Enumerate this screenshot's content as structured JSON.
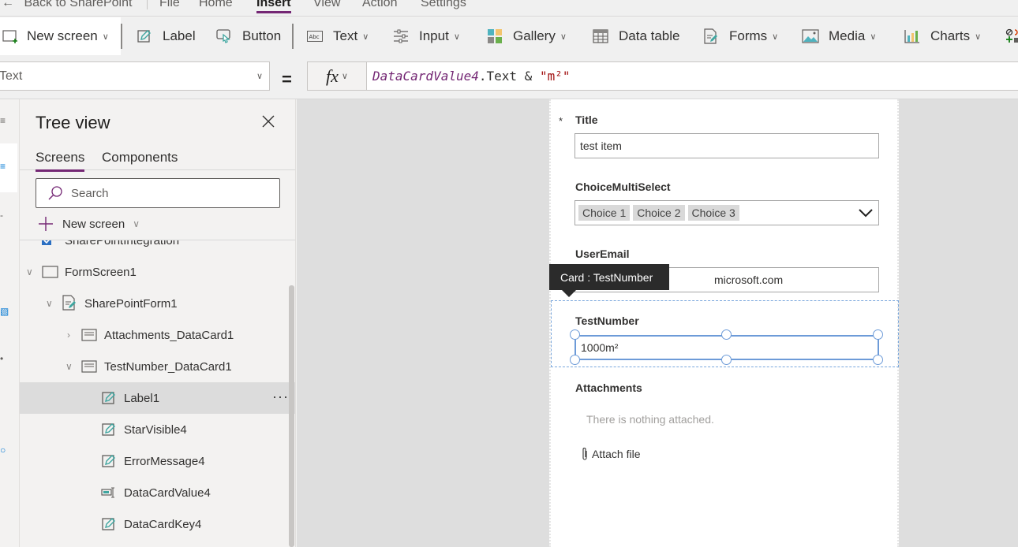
{
  "menubar": {
    "back_label": "Back to SharePoint",
    "items": [
      {
        "label": "File",
        "active": false
      },
      {
        "label": "Home",
        "active": false
      },
      {
        "label": "Insert",
        "active": true
      },
      {
        "label": "View",
        "active": false
      },
      {
        "label": "Action",
        "active": false
      },
      {
        "label": "Settings",
        "active": false
      }
    ]
  },
  "ribbon": {
    "new_screen": "New screen",
    "label": "Label",
    "button": "Button",
    "text": "Text",
    "input": "Input",
    "gallery": "Gallery",
    "data_table": "Data table",
    "forms": "Forms",
    "media": "Media",
    "charts": "Charts"
  },
  "formula_bar": {
    "property": "Text",
    "equals": "=",
    "fx": "fx",
    "formula": {
      "identifier": "DataCardValue4",
      "member": ".Text",
      "operator": " & ",
      "string": "\"m²\""
    }
  },
  "tree_view": {
    "title": "Tree view",
    "tabs": [
      {
        "label": "Screens",
        "active": true
      },
      {
        "label": "Components",
        "active": false
      }
    ],
    "search_placeholder": "Search",
    "new_screen": "New screen",
    "nodes": [
      {
        "label": "SharePointIntegration",
        "icon": "sharepoint-integration-icon",
        "depth": 0
      },
      {
        "label": "FormScreen1",
        "icon": "screen-icon",
        "depth": 0,
        "expanded": true
      },
      {
        "label": "SharePointForm1",
        "icon": "form-icon",
        "depth": 1,
        "expanded": true
      },
      {
        "label": "Attachments_DataCard1",
        "icon": "datacard-icon",
        "depth": 2,
        "expanded": false
      },
      {
        "label": "TestNumber_DataCard1",
        "icon": "datacard-icon",
        "depth": 2,
        "expanded": true
      },
      {
        "label": "Label1",
        "icon": "label-icon",
        "depth": 3,
        "selected": true
      },
      {
        "label": "StarVisible4",
        "icon": "label-icon",
        "depth": 3
      },
      {
        "label": "ErrorMessage4",
        "icon": "label-icon",
        "depth": 3
      },
      {
        "label": "DataCardValue4",
        "icon": "text-input-icon",
        "depth": 3
      },
      {
        "label": "DataCardKey4",
        "icon": "label-icon",
        "depth": 3
      }
    ],
    "more_label": "···"
  },
  "form": {
    "required_marker": "*",
    "title_label": "Title",
    "title_value": "test item",
    "choice_label": "ChoiceMultiSelect",
    "choices": [
      "Choice 1",
      "Choice 2",
      "Choice 3"
    ],
    "email_label": "UserEmail",
    "email_value_visible": "microsoft.com",
    "tooltip": "Card : TestNumber",
    "testnumber_label": "TestNumber",
    "testnumber_value": "1000m²",
    "attachments_label": "Attachments",
    "nothing_attached": "There is nothing attached.",
    "attach_file": "Attach file"
  },
  "colors": {
    "accent": "#742774",
    "selection": "#6d9bd8",
    "identifier": "#742774",
    "string": "#a31515"
  }
}
